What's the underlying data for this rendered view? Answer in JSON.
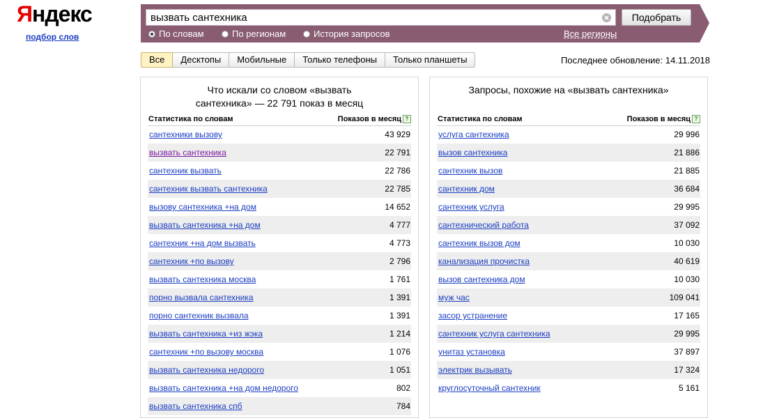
{
  "logo": {
    "part1": "Я",
    "part2": "ндекс"
  },
  "sublink": "подбор слов",
  "search": {
    "value": "вызвать сантехника",
    "button": "Подобрать"
  },
  "radios": [
    {
      "label": "По словам",
      "checked": true
    },
    {
      "label": "По регионам",
      "checked": false
    },
    {
      "label": "История запросов",
      "checked": false
    }
  ],
  "all_regions": "Все регионы",
  "tabs": [
    "Все",
    "Десктопы",
    "Мобильные",
    "Только телефоны",
    "Только планшеты"
  ],
  "active_tab": "Все",
  "last_update": "Последнее обновление: 14.11.2018",
  "colors": {
    "searchbar_bg": "#8a5c72",
    "link": "#1a3dc1",
    "visited": "#7a1b9e",
    "logo_red": "#e60000",
    "active_tab_bg": "#fff3c4"
  },
  "left": {
    "title_line1": "Что искали со словом «вызвать",
    "title_line2": "сантехника» — 22 791 показ в месяц",
    "col1": "Статистика по словам",
    "col2": "Показов в месяц",
    "help": "?",
    "rows": [
      {
        "kw": "сантехники вызову",
        "n": "43 929"
      },
      {
        "kw": "вызвать сантехника",
        "n": "22 791"
      },
      {
        "kw": "сантехник вызвать",
        "n": "22 786"
      },
      {
        "kw": "сантехник вызвать сантехника",
        "n": "22 785"
      },
      {
        "kw": "вызову сантехника +на дом",
        "n": "14 652"
      },
      {
        "kw": "вызвать сантехника +на дом",
        "n": "4 777"
      },
      {
        "kw": "сантехник +на дом вызвать",
        "n": "4 773"
      },
      {
        "kw": "сантехник +по вызову",
        "n": "2 796"
      },
      {
        "kw": "вызвать сантехника москва",
        "n": "1 761"
      },
      {
        "kw": "порно вызвала сантехника",
        "n": "1 391"
      },
      {
        "kw": "порно сантехник вызвала",
        "n": "1 391"
      },
      {
        "kw": "вызвать сантехника +из жэка",
        "n": "1 214"
      },
      {
        "kw": "сантехник +по вызову москва",
        "n": "1 076"
      },
      {
        "kw": "вызвать сантехника недорого",
        "n": "1 051"
      },
      {
        "kw": "вызвать сантехника +на дом недорого",
        "n": "802"
      },
      {
        "kw": "вызвать сантехника спб",
        "n": "784"
      }
    ]
  },
  "right": {
    "title_line1": "Запросы, похожие на «вызвать сантехника»",
    "title_line2": "",
    "col1": "Статистика по словам",
    "col2": "Показов в месяц",
    "help": "?",
    "rows": [
      {
        "kw": "услуга сантехника",
        "n": "29 996"
      },
      {
        "kw": "вызов сантехника",
        "n": "21 886"
      },
      {
        "kw": "сантехник вызов",
        "n": "21 885"
      },
      {
        "kw": "сантехник дом",
        "n": "36 684"
      },
      {
        "kw": "сантехник услуга",
        "n": "29 995"
      },
      {
        "kw": "сантехнический работа",
        "n": "37 092"
      },
      {
        "kw": "сантехник вызов дом",
        "n": "10 030"
      },
      {
        "kw": "канализация прочистка",
        "n": "40 619"
      },
      {
        "kw": "вызов сантехника дом",
        "n": "10 030"
      },
      {
        "kw": "муж час",
        "n": "109 041"
      },
      {
        "kw": "засор устранение",
        "n": "17 165"
      },
      {
        "kw": "сантехник услуга сантехника",
        "n": "29 995"
      },
      {
        "kw": "унитаз установка",
        "n": "37 897"
      },
      {
        "kw": "электрик вызывать",
        "n": "17 324"
      },
      {
        "kw": "круглосуточный сантехник",
        "n": "5 161"
      }
    ]
  }
}
